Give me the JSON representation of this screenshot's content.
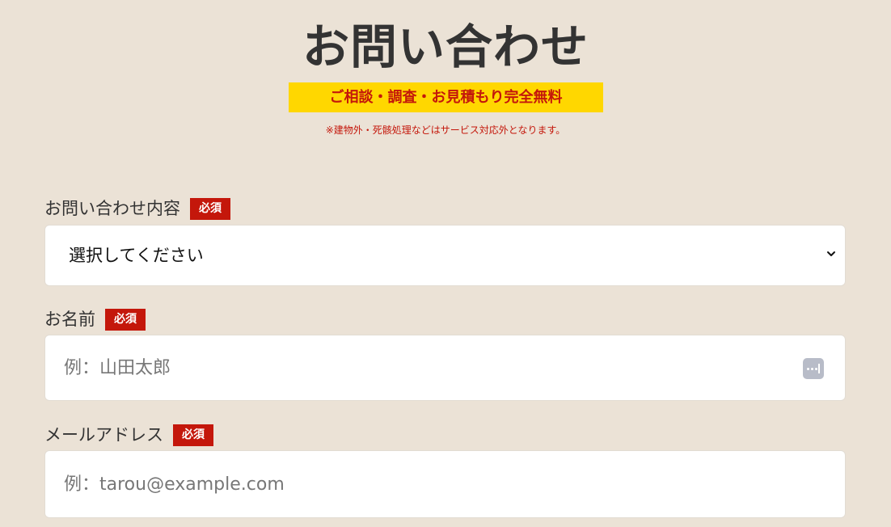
{
  "header": {
    "title": "お問い合わせ",
    "badge": "ご相談・調査・お見積もり完全無料",
    "note": "※建物外・死骸処理などはサービス対応外となります。"
  },
  "form": {
    "required_label": "必須",
    "inquiry": {
      "label": "お問い合わせ内容",
      "selected": "選択してください"
    },
    "name": {
      "label": "お名前",
      "placeholder": "例：山田太郎",
      "value": ""
    },
    "email": {
      "label": "メールアドレス",
      "placeholder": "例：tarou@example.com",
      "value": ""
    }
  },
  "icons": {
    "select_arrow": "chevron-down-icon",
    "autofill": "autofill-icon"
  },
  "colors": {
    "background": "#ebe2d6",
    "badge_background": "#ffd700",
    "accent_red": "#c4170b",
    "text": "#333333",
    "field_background": "#ffffff"
  }
}
